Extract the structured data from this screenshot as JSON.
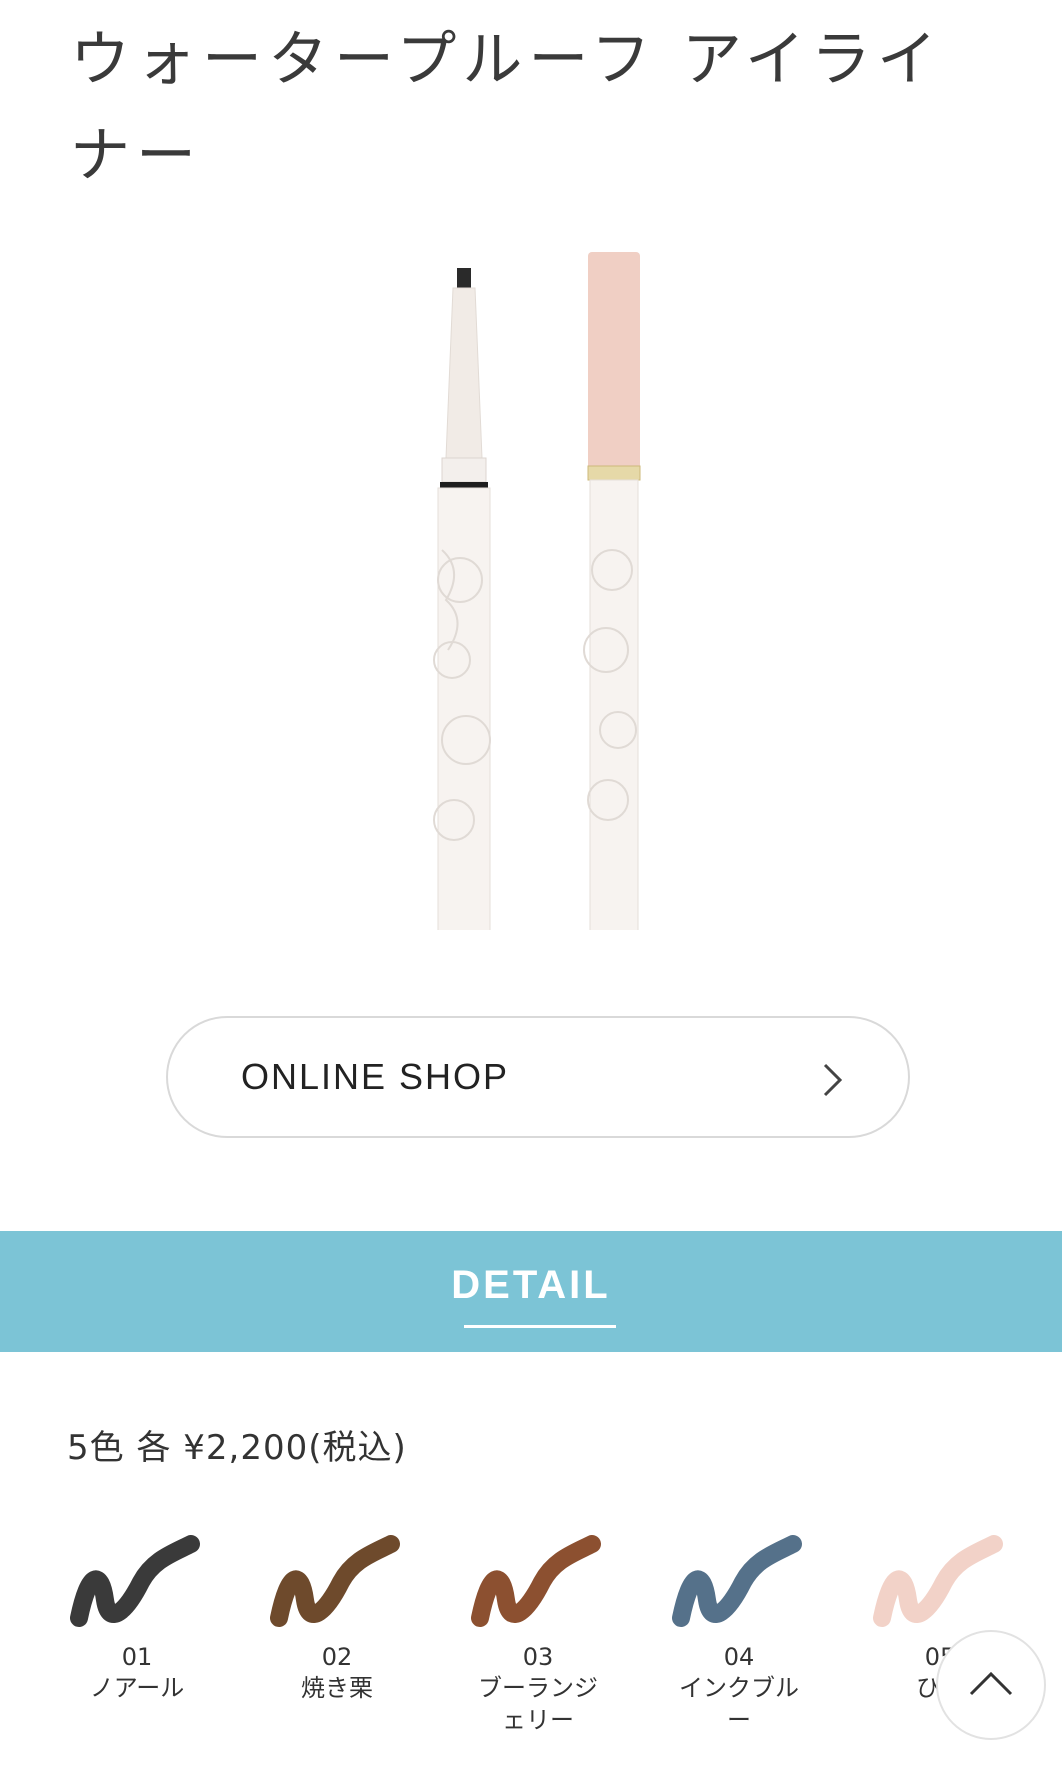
{
  "product": {
    "title": "ウォータープルーフ アイライナー"
  },
  "online_shop": {
    "label": "ONLINE SHOP"
  },
  "detail": {
    "label": "DETAIL"
  },
  "price_text": "5色 各 ¥2,200(税込)",
  "swatches": [
    {
      "code": "01",
      "name": "ノアール",
      "color": "#3a3a3a"
    },
    {
      "code": "02",
      "name": "焼き栗",
      "color": "#6e4a2c"
    },
    {
      "code": "03",
      "name": "ブーランジェリー",
      "color": "#8c5030"
    },
    {
      "code": "04",
      "name": "インクブルー",
      "color": "#55718a"
    },
    {
      "code": "05",
      "name": "ひか",
      "color": "#f2d2c8"
    }
  ],
  "colors": {
    "accent": "#7cc4d6",
    "cap_pink": "#f0cfc4"
  }
}
